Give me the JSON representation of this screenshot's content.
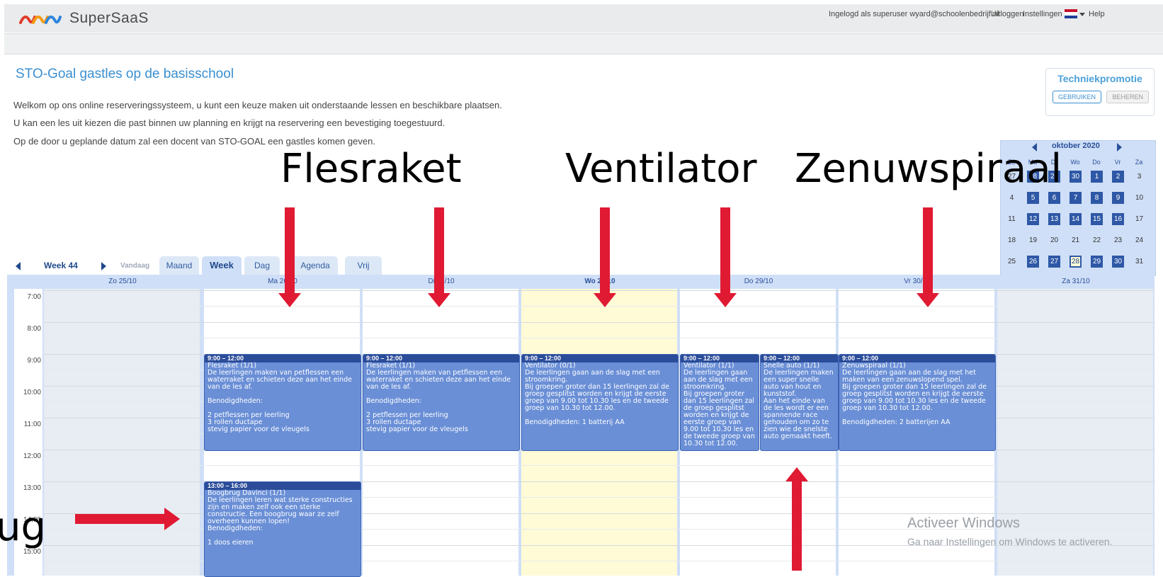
{
  "app": {
    "name": "SuperSaaS"
  },
  "topnav": {
    "logged_in": "Ingelogd als superuser wyard@schoolenbedrijf.nl",
    "logout": "Uitloggen",
    "settings": "Instellingen",
    "help": "Help"
  },
  "page": {
    "title": "STO-Goal gastles op de basisschool",
    "intro": [
      "Welkom op ons online reserveringssysteem, u kunt een keuze maken uit onderstaande lessen en beschikbare plaatsen.",
      "U kan een les uit kiezen die past binnen uw planning en krijgt na reservering een bevestiging toegestuurd.",
      "Op de door u geplande datum zal een docent van STO-GOAL een gastles komen geven."
    ]
  },
  "resource_box": {
    "title": "Techniekpromotie",
    "use_label": "GEBRUIKEN",
    "manage_label": "BEHEREN"
  },
  "mini_calendar": {
    "month": "oktober 2020",
    "weekdays": [
      "Zo",
      "Ma",
      "Di",
      "Wo",
      "Do",
      "Vr",
      "Za"
    ],
    "weeks": [
      [
        "27",
        "28",
        "29",
        "30",
        "1",
        "2",
        "3"
      ],
      [
        "4",
        "5",
        "6",
        "7",
        "8",
        "9",
        "10"
      ],
      [
        "11",
        "12",
        "13",
        "14",
        "15",
        "16",
        "17"
      ],
      [
        "18",
        "19",
        "20",
        "21",
        "22",
        "23",
        "24"
      ],
      [
        "25",
        "26",
        "27",
        "28",
        "29",
        "30",
        "31"
      ]
    ]
  },
  "toolbar": {
    "week_label": "Week 44",
    "today_label": "Vandaag",
    "tabs": [
      "Maand",
      "Week",
      "Dag",
      "Agenda",
      "Vrij"
    ]
  },
  "days": [
    "Zo 25/10",
    "Ma 26/10",
    "Di 27/10",
    "Wo 28/10",
    "Do 29/10",
    "Vr 30/10",
    "Za 31/10"
  ],
  "hours": [
    "7:00",
    "8:00",
    "9:00",
    "10:00",
    "11:00",
    "12:00",
    "13:00",
    "14:00",
    "15:00"
  ],
  "appointments": [
    {
      "time": "9:00 – 12:00",
      "body": "Flesraket (1/1)\nDe leerlingen maken van petflessen een waterraket en schieten deze aan het einde van de les af.\n\nBenodigdheden:\n\n2 petflessen per leerling\n3 rollen ductape\nstevig papier voor de vleugels"
    },
    {
      "time": "9:00 – 12:00",
      "body": "Flesraket (1/1)\nDe leerlingen maken van petflessen een waterraket en schieten deze aan het einde van de les af.\n\nBenodigdheden:\n\n2 petflessen per leerling\n3 rollen ductape\nstevig papier voor de vleugels"
    },
    {
      "time": "9:00 – 12:00",
      "body": "Ventilator (0/1)\nDe leerlingen gaan aan de slag met een stroomkring.\nBij groepen groter dan 15 leerlingen zal de groep gesplitst worden en krijgt de eerste groep van 9.00 tot 10.30 les en de tweede groep van 10.30 tot 12.00.\n\nBenodigdheden: 1 batterij AA"
    },
    {
      "time": "9:00 – 12:00",
      "body": "Ventilator (1/1)\nDe leerlingen gaan aan de slag met een stroomkring.\nBij groepen groter dan 15 leerlingen zal de groep gesplitst worden en krijgt de eerste groep van 9.00 tot 10.30 les en de tweede groep van 10.30 tot 12.00."
    },
    {
      "time": "9:00 – 12:00",
      "body": "Snelle auto (1/1)\nDe leerlingen maken een super snelle auto van hout en kunststof.\nAan het einde van de les wordt er een spannende race gehouden om zo te zien wie de snelste auto gemaakt heeft."
    },
    {
      "time": "9:00 – 12:00",
      "body": "Zenuwspiraal (1/1)\nDe leerlingen gaan aan de slag met het maken van een zenuwslopend spel.\nBij groepen groter dan 15 leerlingen zal de groep gesplitst worden en krijgt de eerste groep van 9.00 tot 10.30 les en de tweede groep van 10.30 tot 12.00.\n\nBenodigdheden: 2 batterijen AA"
    },
    {
      "time": "13:00 – 16:00",
      "body": "Boogbrug Davinci (1/1)\nDe leerlingen leren wat sterke constructies zijn en maken zelf ook een sterke constructie. Een boogbrug waar ze zelf overheen kunnen lopen!\nBenodigdheden:\n\n1 doos eieren"
    }
  ],
  "overlay_labels": {
    "a": "Flesraket",
    "b": "Ventilator",
    "c": "Zenuwspiraal",
    "d": "ug"
  },
  "watermark": {
    "line1": "Activeer Windows",
    "line2": "Ga naar Instellingen om Windows te activeren."
  },
  "colors": {
    "accent": "#3a8fd0",
    "event": "#6a8fd6",
    "event_header": "#2b4c99",
    "today_column": "#fffbd6",
    "arrow": "#e01a33"
  }
}
